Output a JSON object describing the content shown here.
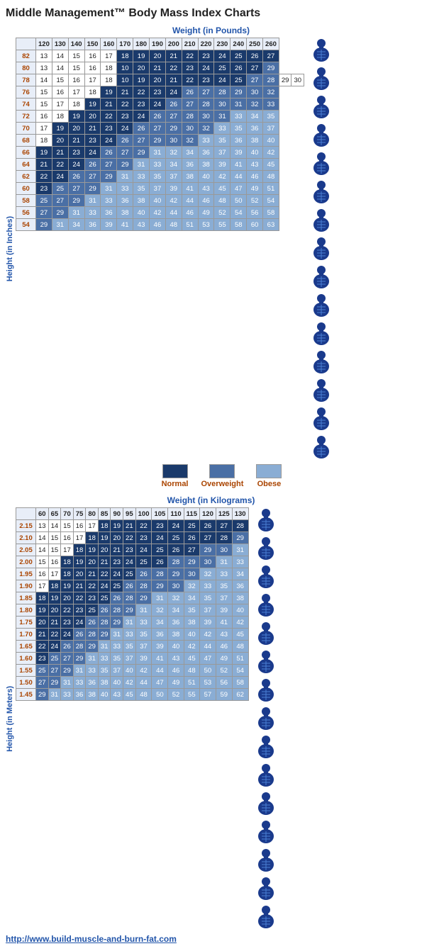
{
  "title": "Middle Management™ Body Mass Index Charts",
  "pounds_section": {
    "label": "Weight (in Pounds)",
    "y_label": "Height (in Inches)",
    "col_headers": [
      "",
      "120",
      "130",
      "140",
      "150",
      "160",
      "170",
      "180",
      "190",
      "200",
      "210",
      "220",
      "230",
      "240",
      "250",
      "260"
    ],
    "rows": [
      {
        "h": "82",
        "vals": [
          "13",
          "14",
          "15",
          "16",
          "17",
          "18",
          "19",
          "20",
          "21",
          "22",
          "23",
          "24",
          "25",
          "26",
          "27"
        ],
        "classes": [
          "p",
          "p",
          "p",
          "p",
          "p",
          "n",
          "n",
          "n",
          "n",
          "n",
          "n",
          "n",
          "n",
          "n",
          "n"
        ]
      },
      {
        "h": "80",
        "vals": [
          "13",
          "14",
          "15",
          "16",
          "18",
          "10",
          "20",
          "21",
          "22",
          "23",
          "24",
          "25",
          "26",
          "27",
          "29"
        ],
        "classes": [
          "p",
          "p",
          "p",
          "p",
          "p",
          "n",
          "n",
          "n",
          "n",
          "n",
          "n",
          "n",
          "n",
          "n",
          "ow"
        ]
      },
      {
        "h": "78",
        "vals": [
          "14",
          "15",
          "16",
          "17",
          "18",
          "10",
          "19",
          "20",
          "21",
          "22",
          "23",
          "24",
          "25",
          "27",
          "28",
          "29",
          "30"
        ],
        "classes": [
          "p",
          "p",
          "p",
          "p",
          "p",
          "n",
          "n",
          "n",
          "n",
          "n",
          "n",
          "n",
          "n",
          "ow",
          "ow"
        ]
      },
      {
        "h": "76",
        "vals": [
          "15",
          "16",
          "17",
          "18",
          "19",
          "21",
          "22",
          "23",
          "24",
          "26",
          "27",
          "28",
          "29",
          "30",
          "32"
        ],
        "classes": [
          "p",
          "p",
          "p",
          "p",
          "n",
          "n",
          "n",
          "n",
          "n",
          "ow",
          "ow",
          "ow",
          "ow",
          "ow",
          "ow"
        ]
      },
      {
        "h": "74",
        "vals": [
          "15",
          "17",
          "18",
          "19",
          "21",
          "22",
          "23",
          "24",
          "26",
          "27",
          "28",
          "30",
          "31",
          "32",
          "33"
        ],
        "classes": [
          "p",
          "p",
          "p",
          "n",
          "n",
          "n",
          "n",
          "n",
          "ow",
          "ow",
          "ow",
          "ow",
          "ow",
          "ow",
          "ow"
        ]
      },
      {
        "h": "72",
        "vals": [
          "16",
          "18",
          "19",
          "20",
          "22",
          "23",
          "24",
          "26",
          "27",
          "28",
          "30",
          "31",
          "33",
          "34",
          "35"
        ],
        "classes": [
          "p",
          "p",
          "n",
          "n",
          "n",
          "n",
          "n",
          "ow",
          "ow",
          "ow",
          "ow",
          "ow",
          "ob",
          "ob",
          "ob"
        ]
      },
      {
        "h": "70",
        "vals": [
          "17",
          "19",
          "20",
          "21",
          "23",
          "24",
          "26",
          "27",
          "29",
          "30",
          "32",
          "33",
          "35",
          "36",
          "37"
        ],
        "classes": [
          "p",
          "n",
          "n",
          "n",
          "n",
          "n",
          "ow",
          "ow",
          "ow",
          "ow",
          "ow",
          "ob",
          "ob",
          "ob",
          "ob"
        ]
      },
      {
        "h": "68",
        "vals": [
          "18",
          "20",
          "21",
          "23",
          "24",
          "26",
          "27",
          "29",
          "30",
          "32",
          "33",
          "35",
          "36",
          "38",
          "40"
        ],
        "classes": [
          "p",
          "n",
          "n",
          "n",
          "n",
          "ow",
          "ow",
          "ow",
          "ow",
          "ow",
          "ob",
          "ob",
          "ob",
          "ob",
          "ob"
        ]
      },
      {
        "h": "66",
        "vals": [
          "19",
          "21",
          "23",
          "24",
          "26",
          "27",
          "29",
          "31",
          "32",
          "34",
          "36",
          "37",
          "39",
          "40",
          "42"
        ],
        "classes": [
          "n",
          "n",
          "n",
          "n",
          "ow",
          "ow",
          "ow",
          "ob",
          "ob",
          "ob",
          "ob",
          "ob",
          "ob",
          "ob",
          "ob"
        ]
      },
      {
        "h": "64",
        "vals": [
          "21",
          "22",
          "24",
          "26",
          "27",
          "29",
          "31",
          "33",
          "34",
          "36",
          "38",
          "39",
          "41",
          "43",
          "45"
        ],
        "classes": [
          "n",
          "n",
          "n",
          "ow",
          "ow",
          "ow",
          "ob",
          "ob",
          "ob",
          "ob",
          "ob",
          "ob",
          "ob",
          "ob",
          "ob"
        ]
      },
      {
        "h": "62",
        "vals": [
          "22",
          "24",
          "26",
          "27",
          "29",
          "31",
          "33",
          "35",
          "37",
          "38",
          "40",
          "42",
          "44",
          "46",
          "48"
        ],
        "classes": [
          "n",
          "n",
          "ow",
          "ow",
          "ow",
          "ob",
          "ob",
          "ob",
          "ob",
          "ob",
          "ob",
          "ob",
          "ob",
          "ob",
          "ob"
        ]
      },
      {
        "h": "60",
        "vals": [
          "23",
          "25",
          "27",
          "29",
          "31",
          "33",
          "35",
          "37",
          "39",
          "41",
          "43",
          "45",
          "47",
          "49",
          "51"
        ],
        "classes": [
          "n",
          "ow",
          "ow",
          "ow",
          "ob",
          "ob",
          "ob",
          "ob",
          "ob",
          "ob",
          "ob",
          "ob",
          "ob",
          "ob",
          "ob"
        ]
      },
      {
        "h": "58",
        "vals": [
          "25",
          "27",
          "29",
          "31",
          "33",
          "36",
          "38",
          "40",
          "42",
          "44",
          "46",
          "48",
          "50",
          "52",
          "54"
        ],
        "classes": [
          "ow",
          "ow",
          "ow",
          "ob",
          "ob",
          "ob",
          "ob",
          "ob",
          "ob",
          "ob",
          "ob",
          "ob",
          "ob",
          "ob",
          "ob"
        ]
      },
      {
        "h": "56",
        "vals": [
          "27",
          "29",
          "31",
          "33",
          "36",
          "38",
          "40",
          "42",
          "44",
          "46",
          "49",
          "52",
          "54",
          "56",
          "58"
        ],
        "classes": [
          "ow",
          "ow",
          "ob",
          "ob",
          "ob",
          "ob",
          "ob",
          "ob",
          "ob",
          "ob",
          "ob",
          "ob",
          "ob",
          "ob",
          "ob"
        ]
      },
      {
        "h": "54",
        "vals": [
          "29",
          "31",
          "34",
          "36",
          "39",
          "41",
          "43",
          "46",
          "48",
          "51",
          "53",
          "55",
          "58",
          "60",
          "63"
        ],
        "classes": [
          "ow",
          "ob",
          "ob",
          "ob",
          "ob",
          "ob",
          "ob",
          "ob",
          "ob",
          "ob",
          "ob",
          "ob",
          "ob",
          "ob",
          "ob"
        ]
      }
    ]
  },
  "kg_section": {
    "label": "Weight (in Kilograms)",
    "y_label": "Height (in Meters)",
    "col_headers": [
      "",
      "60",
      "65",
      "70",
      "75",
      "80",
      "85",
      "90",
      "95",
      "100",
      "105",
      "110",
      "115",
      "120",
      "125",
      "130"
    ],
    "rows": [
      {
        "h": "2.15",
        "vals": [
          "13",
          "14",
          "15",
          "16",
          "17",
          "18",
          "19",
          "21",
          "22",
          "23",
          "24",
          "25",
          "26",
          "27",
          "28"
        ],
        "classes": [
          "p",
          "p",
          "p",
          "p",
          "p",
          "n",
          "n",
          "n",
          "n",
          "n",
          "n",
          "n",
          "n",
          "n",
          "n"
        ]
      },
      {
        "h": "2.10",
        "vals": [
          "14",
          "15",
          "16",
          "17",
          "18",
          "19",
          "20",
          "22",
          "23",
          "24",
          "25",
          "26",
          "27",
          "28",
          "29"
        ],
        "classes": [
          "p",
          "p",
          "p",
          "p",
          "n",
          "n",
          "n",
          "n",
          "n",
          "n",
          "n",
          "n",
          "n",
          "n",
          "ow"
        ]
      },
      {
        "h": "2.05",
        "vals": [
          "14",
          "15",
          "17",
          "18",
          "19",
          "20",
          "21",
          "23",
          "24",
          "25",
          "26",
          "27",
          "29",
          "30",
          "31"
        ],
        "classes": [
          "p",
          "p",
          "p",
          "n",
          "n",
          "n",
          "n",
          "n",
          "n",
          "n",
          "n",
          "n",
          "ow",
          "ow",
          "ob"
        ]
      },
      {
        "h": "2.00",
        "vals": [
          "15",
          "16",
          "18",
          "19",
          "20",
          "21",
          "23",
          "24",
          "25",
          "26",
          "28",
          "29",
          "30",
          "31",
          "33"
        ],
        "classes": [
          "p",
          "p",
          "n",
          "n",
          "n",
          "n",
          "n",
          "n",
          "n",
          "n",
          "ow",
          "ow",
          "ow",
          "ob",
          "ob"
        ]
      },
      {
        "h": "1.95",
        "vals": [
          "16",
          "17",
          "18",
          "20",
          "21",
          "22",
          "24",
          "25",
          "26",
          "28",
          "29",
          "30",
          "32",
          "33",
          "34"
        ],
        "classes": [
          "p",
          "p",
          "n",
          "n",
          "n",
          "n",
          "n",
          "n",
          "ow",
          "ow",
          "ow",
          "ow",
          "ob",
          "ob",
          "ob"
        ]
      },
      {
        "h": "1.90",
        "vals": [
          "17",
          "18",
          "19",
          "21",
          "22",
          "24",
          "25",
          "26",
          "28",
          "29",
          "30",
          "32",
          "33",
          "35",
          "36"
        ],
        "classes": [
          "p",
          "n",
          "n",
          "n",
          "n",
          "n",
          "n",
          "ow",
          "ow",
          "ow",
          "ow",
          "ob",
          "ob",
          "ob",
          "ob"
        ]
      },
      {
        "h": "1.85",
        "vals": [
          "18",
          "19",
          "20",
          "22",
          "23",
          "25",
          "26",
          "28",
          "29",
          "31",
          "32",
          "34",
          "35",
          "37",
          "38"
        ],
        "classes": [
          "n",
          "n",
          "n",
          "n",
          "n",
          "n",
          "ow",
          "ow",
          "ow",
          "ob",
          "ob",
          "ob",
          "ob",
          "ob",
          "ob"
        ]
      },
      {
        "h": "1.80",
        "vals": [
          "19",
          "20",
          "22",
          "23",
          "25",
          "26",
          "28",
          "29",
          "31",
          "32",
          "34",
          "35",
          "37",
          "39",
          "40"
        ],
        "classes": [
          "n",
          "n",
          "n",
          "n",
          "n",
          "ow",
          "ow",
          "ow",
          "ob",
          "ob",
          "ob",
          "ob",
          "ob",
          "ob",
          "ob"
        ]
      },
      {
        "h": "1.75",
        "vals": [
          "20",
          "21",
          "23",
          "24",
          "26",
          "28",
          "29",
          "31",
          "33",
          "34",
          "36",
          "38",
          "39",
          "41",
          "42"
        ],
        "classes": [
          "n",
          "n",
          "n",
          "n",
          "ow",
          "ow",
          "ow",
          "ob",
          "ob",
          "ob",
          "ob",
          "ob",
          "ob",
          "ob",
          "ob"
        ]
      },
      {
        "h": "1.70",
        "vals": [
          "21",
          "22",
          "24",
          "26",
          "28",
          "29",
          "31",
          "33",
          "35",
          "36",
          "38",
          "40",
          "42",
          "43",
          "45"
        ],
        "classes": [
          "n",
          "n",
          "n",
          "ow",
          "ow",
          "ow",
          "ob",
          "ob",
          "ob",
          "ob",
          "ob",
          "ob",
          "ob",
          "ob",
          "ob"
        ]
      },
      {
        "h": "1.65",
        "vals": [
          "22",
          "24",
          "26",
          "28",
          "29",
          "31",
          "33",
          "35",
          "37",
          "39",
          "40",
          "42",
          "44",
          "46",
          "48"
        ],
        "classes": [
          "n",
          "n",
          "ow",
          "ow",
          "ow",
          "ob",
          "ob",
          "ob",
          "ob",
          "ob",
          "ob",
          "ob",
          "ob",
          "ob",
          "ob"
        ]
      },
      {
        "h": "1.60",
        "vals": [
          "23",
          "25",
          "27",
          "29",
          "31",
          "33",
          "35",
          "37",
          "39",
          "41",
          "43",
          "45",
          "47",
          "49",
          "51"
        ],
        "classes": [
          "n",
          "ow",
          "ow",
          "ow",
          "ob",
          "ob",
          "ob",
          "ob",
          "ob",
          "ob",
          "ob",
          "ob",
          "ob",
          "ob",
          "ob"
        ]
      },
      {
        "h": "1.55",
        "vals": [
          "25",
          "27",
          "29",
          "31",
          "33",
          "35",
          "37",
          "40",
          "42",
          "44",
          "46",
          "48",
          "50",
          "52",
          "54"
        ],
        "classes": [
          "ow",
          "ow",
          "ow",
          "ob",
          "ob",
          "ob",
          "ob",
          "ob",
          "ob",
          "ob",
          "ob",
          "ob",
          "ob",
          "ob",
          "ob"
        ]
      },
      {
        "h": "1.50",
        "vals": [
          "27",
          "29",
          "31",
          "33",
          "36",
          "38",
          "40",
          "42",
          "44",
          "47",
          "49",
          "51",
          "53",
          "56",
          "58"
        ],
        "classes": [
          "ow",
          "ow",
          "ob",
          "ob",
          "ob",
          "ob",
          "ob",
          "ob",
          "ob",
          "ob",
          "ob",
          "ob",
          "ob",
          "ob",
          "ob"
        ]
      },
      {
        "h": "1.45",
        "vals": [
          "29",
          "31",
          "33",
          "36",
          "38",
          "40",
          "43",
          "45",
          "48",
          "50",
          "52",
          "55",
          "57",
          "59",
          "62"
        ],
        "classes": [
          "ow",
          "ob",
          "ob",
          "ob",
          "ob",
          "ob",
          "ob",
          "ob",
          "ob",
          "ob",
          "ob",
          "ob",
          "ob",
          "ob",
          "ob"
        ]
      }
    ]
  },
  "legend": {
    "items": [
      {
        "label": "Normal",
        "class": "lb-normal"
      },
      {
        "label": "Overweight",
        "class": "lb-overweight"
      },
      {
        "label": "Obese",
        "class": "lb-obese"
      }
    ]
  },
  "footer_url": "http://www.build-muscle-and-burn-fat.com",
  "abs_icons_count": 15
}
